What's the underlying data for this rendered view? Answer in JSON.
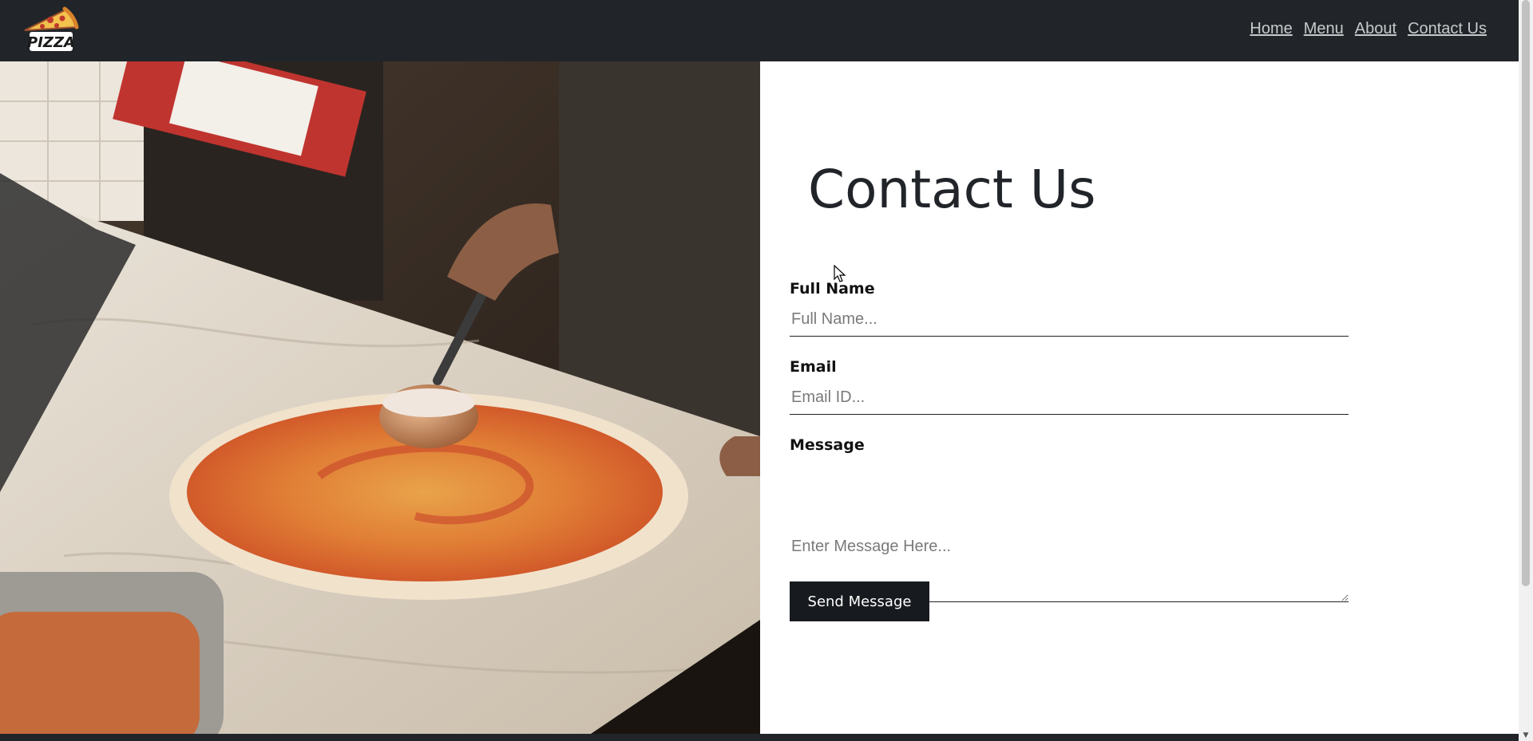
{
  "header": {
    "logo_text": "PIZZA",
    "nav_links": [
      "Home",
      "Menu",
      "About",
      "Contact Us"
    ]
  },
  "contact": {
    "title": "Contact Us",
    "full_name_label": "Full Name",
    "full_name_placeholder": "Full Name...",
    "email_label": "Email",
    "email_placeholder": "Email ID...",
    "message_label": "Message",
    "message_placeholder": "Enter Message Here...",
    "send_label": "Send Message"
  },
  "colors": {
    "navbar": "#212529",
    "nav_link": "#c8c9cb",
    "button": "#171a1e"
  },
  "icons": {
    "logo": "pizza-slice-logo",
    "scroll_down": "chevron-down-icon",
    "cursor": "mouse-pointer-icon"
  }
}
